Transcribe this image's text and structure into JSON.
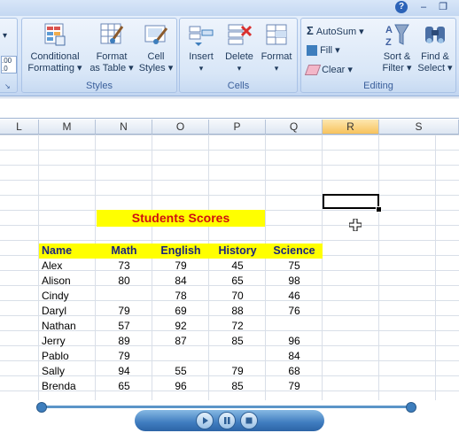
{
  "window": {
    "help_label": "?",
    "minimize_label": "–",
    "restore_label": "❐"
  },
  "ribbon": {
    "styles": {
      "label": "Styles",
      "conditional_formatting": [
        "Conditional",
        "Formatting ▾"
      ],
      "format_as_table": [
        "Format",
        "as Table ▾"
      ],
      "cell_styles": [
        "Cell",
        "Styles ▾"
      ]
    },
    "cells": {
      "label": "Cells",
      "insert": "Insert",
      "delete": "Delete",
      "format": "Format"
    },
    "editing": {
      "label": "Editing",
      "autosum": "AutoSum ▾",
      "fill": "Fill ▾",
      "clear": "Clear ▾",
      "sort_filter": [
        "Sort &",
        "Filter ▾"
      ],
      "find_select": [
        "Find &",
        "Select ▾"
      ]
    },
    "number_decimal_label": ".00\n.0"
  },
  "columns": [
    "L",
    "M",
    "N",
    "O",
    "P",
    "Q",
    "R",
    "S"
  ],
  "selected_column": "R",
  "sheet": {
    "title": "Students Scores",
    "headers": [
      "Name",
      "Math",
      "English",
      "History",
      "Science"
    ],
    "rows": [
      [
        "Alex",
        "73",
        "79",
        "45",
        "75"
      ],
      [
        "Alison",
        "80",
        "84",
        "65",
        "98"
      ],
      [
        "Cindy",
        "",
        "78",
        "70",
        "46"
      ],
      [
        "Daryl",
        "79",
        "69",
        "88",
        "76"
      ],
      [
        "Nathan",
        "57",
        "92",
        "72",
        ""
      ],
      [
        "Jerry",
        "89",
        "87",
        "85",
        "96"
      ],
      [
        "Pablo",
        "79",
        "",
        "",
        "84"
      ],
      [
        "Sally",
        "94",
        "55",
        "79",
        "68"
      ],
      [
        "Brenda",
        "65",
        "96",
        "85",
        "79"
      ]
    ]
  },
  "colors": {
    "header_fill": "#ffff00",
    "title_text": "#d01010",
    "header_text": "#1a237e",
    "selected_col": "#f7c25c"
  }
}
